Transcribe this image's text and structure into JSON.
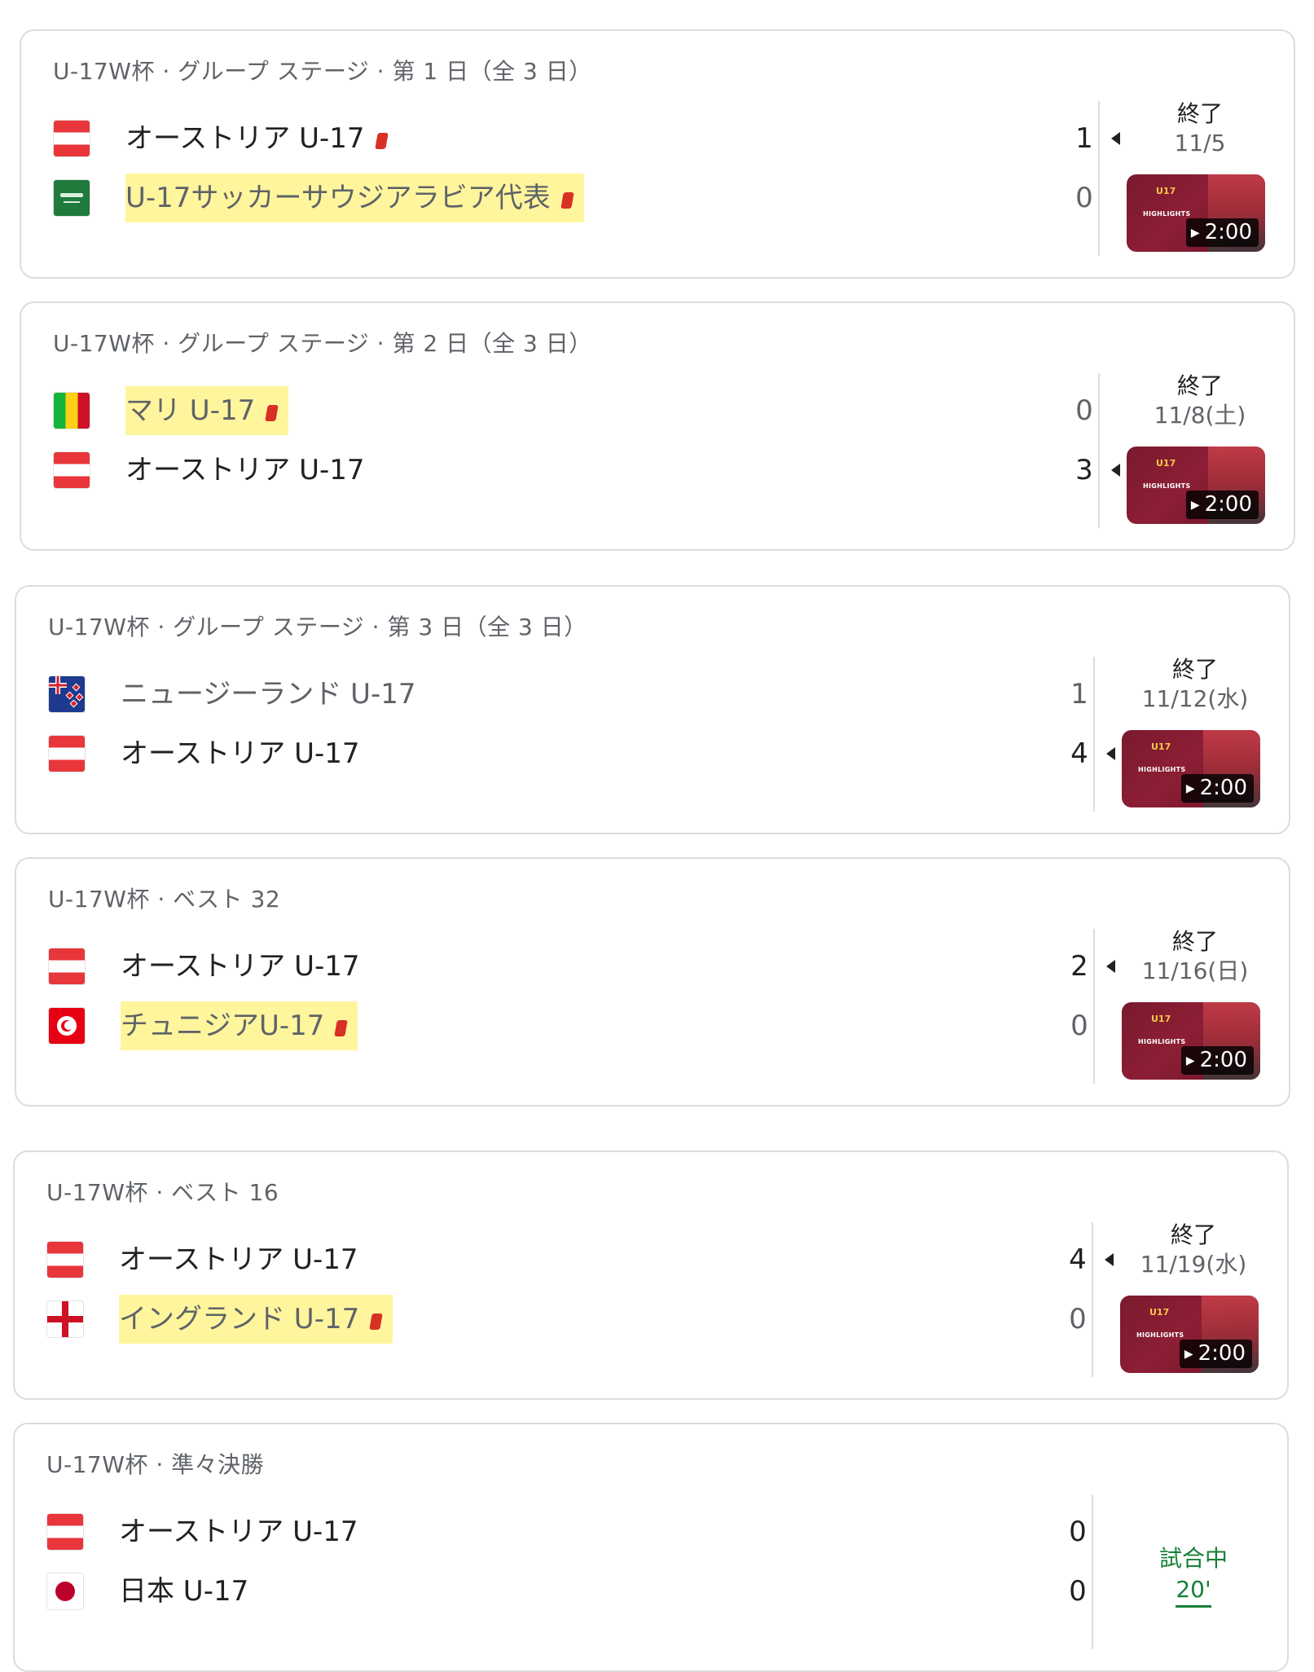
{
  "matches": [
    {
      "header": "U-17W杯 · グループ ステージ · 第 1 日（全 3 日）",
      "home": {
        "name": "オーストリア U-17",
        "score": "1",
        "flag": "austria-flag",
        "winner": true,
        "red_card": true,
        "highlighted": false
      },
      "away": {
        "name": "U-17サッカーサウジアラビア代表",
        "score": "0",
        "flag": "saudi-arabia-flag",
        "winner": false,
        "red_card": true,
        "highlighted": true
      },
      "status": "終了",
      "date": "11/5",
      "video": {
        "duration": "2:00",
        "label": "HIGHLIGHTS"
      }
    },
    {
      "header": "U-17W杯 · グループ ステージ · 第 2 日（全 3 日）",
      "home": {
        "name": "マリ U-17",
        "score": "0",
        "flag": "mali-flag",
        "winner": false,
        "red_card": true,
        "highlighted": true
      },
      "away": {
        "name": "オーストリア U-17",
        "score": "3",
        "flag": "austria-flag",
        "winner": true,
        "red_card": false,
        "highlighted": false
      },
      "status": "終了",
      "date": "11/8(土)",
      "video": {
        "duration": "2:00",
        "label": "HIGHLIGHTS"
      }
    },
    {
      "header": "U-17W杯 · グループ ステージ · 第 3 日（全 3 日）",
      "home": {
        "name": "ニュージーランド U-17",
        "score": "1",
        "flag": "new-zealand-flag",
        "winner": false,
        "red_card": false,
        "highlighted": false
      },
      "away": {
        "name": "オーストリア U-17",
        "score": "4",
        "flag": "austria-flag",
        "winner": true,
        "red_card": false,
        "highlighted": false
      },
      "status": "終了",
      "date": "11/12(水)",
      "video": {
        "duration": "2:00",
        "label": "HIGHLIGHTS"
      }
    },
    {
      "header": "U-17W杯 · ベスト 32",
      "home": {
        "name": "オーストリア U-17",
        "score": "2",
        "flag": "austria-flag",
        "winner": true,
        "red_card": false,
        "highlighted": false
      },
      "away": {
        "name": "チュニジアU-17",
        "score": "0",
        "flag": "tunisia-flag",
        "winner": false,
        "red_card": true,
        "highlighted": true
      },
      "status": "終了",
      "date": "11/16(日)",
      "video": {
        "duration": "2:00",
        "label": "HIGHLIGHTS"
      }
    },
    {
      "header": "U-17W杯 · ベスト 16",
      "home": {
        "name": "オーストリア U-17",
        "score": "4",
        "flag": "austria-flag",
        "winner": true,
        "red_card": false,
        "highlighted": false
      },
      "away": {
        "name": "イングランド U-17",
        "score": "0",
        "flag": "england-flag",
        "winner": false,
        "red_card": true,
        "highlighted": true
      },
      "status": "終了",
      "date": "11/19(水)",
      "video": {
        "duration": "2:00",
        "label": "HIGHLIGHTS"
      }
    },
    {
      "header": "U-17W杯 · 準々決勝",
      "home": {
        "name": "オーストリア U-17",
        "score": "0",
        "flag": "austria-flag",
        "winner": false,
        "red_card": false,
        "highlighted": false
      },
      "away": {
        "name": "日本 U-17",
        "score": "0",
        "flag": "japan-flag",
        "winner": false,
        "red_card": false,
        "highlighted": false
      },
      "live": {
        "status": "試合中",
        "minute": "20'"
      }
    }
  ],
  "colors": {
    "highlight": "#fff59d",
    "red_card": "#d93025",
    "live": "#188038",
    "border": "#dadce0"
  }
}
